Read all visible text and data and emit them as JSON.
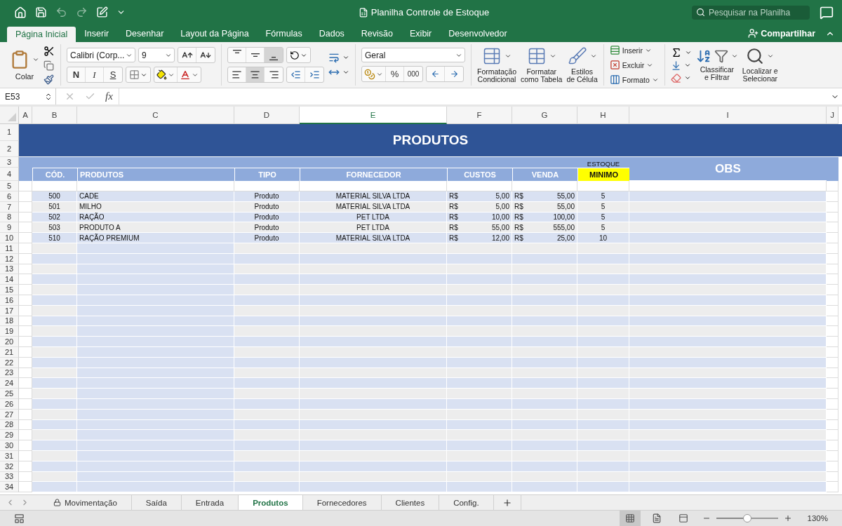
{
  "title_bar": {
    "title": "Planilha Controle de Estoque",
    "search_placeholder": "Pesquisar na Planilha"
  },
  "ribbon_tabs": [
    {
      "label": "Página Inicial",
      "selected": true
    },
    {
      "label": "Inserir",
      "selected": false
    },
    {
      "label": "Desenhar",
      "selected": false
    },
    {
      "label": "Layout da Página",
      "selected": false
    },
    {
      "label": "Fórmulas",
      "selected": false
    },
    {
      "label": "Dados",
      "selected": false
    },
    {
      "label": "Revisão",
      "selected": false
    },
    {
      "label": "Exibir",
      "selected": false
    },
    {
      "label": "Desenvolvedor",
      "selected": false
    }
  ],
  "share_label": "Compartilhar",
  "ribbon": {
    "paste_label": "Colar",
    "font_name": "Calibri (Corp...",
    "font_size": "9",
    "style_buttons": [
      {
        "kind": "bold",
        "label": "N"
      },
      {
        "kind": "italic",
        "label": "I"
      },
      {
        "kind": "underline",
        "label": "S"
      }
    ],
    "vertical_align": [
      {
        "kind": "top",
        "selected": false
      },
      {
        "kind": "middle",
        "selected": false
      },
      {
        "kind": "bottom",
        "selected": true
      }
    ],
    "horizontal_align": [
      {
        "kind": "left",
        "selected": false
      },
      {
        "kind": "center",
        "selected": true
      },
      {
        "kind": "right",
        "selected": false
      }
    ],
    "number_format": "Geral",
    "percent_label": "%",
    "thousands_label": "000",
    "large_buttons": [
      {
        "kind": "conditional",
        "label": "Formatação\nCondicional"
      },
      {
        "kind": "table",
        "label": "Formatar\ncomo Tabela"
      },
      {
        "kind": "cell_styles",
        "label": "Estilos\nde Célula"
      }
    ],
    "cells_buttons": [
      {
        "kind": "insert",
        "label": "Inserir"
      },
      {
        "kind": "delete",
        "label": "Excluir"
      },
      {
        "kind": "format",
        "label": "Formato"
      }
    ],
    "edit_buttons": [
      {
        "kind": "sort",
        "label": "Classificar\ne Filtrar"
      },
      {
        "kind": "find",
        "label": "Localizar e\nSelecionar"
      }
    ]
  },
  "formula_bar": {
    "name_box": "E53",
    "fx_label": "fx"
  },
  "sheet": {
    "columns": [
      {
        "label": "A",
        "selected": false
      },
      {
        "label": "B",
        "selected": false
      },
      {
        "label": "C",
        "selected": false
      },
      {
        "label": "D",
        "selected": false
      },
      {
        "label": "E",
        "selected": true
      },
      {
        "label": "F",
        "selected": false
      },
      {
        "label": "G",
        "selected": false
      },
      {
        "label": "H",
        "selected": false
      },
      {
        "label": "I",
        "selected": false
      },
      {
        "label": "J",
        "selected": false
      }
    ],
    "row_numbers": [
      "1",
      "2",
      "3",
      "4",
      "5",
      "6",
      "7",
      "8",
      "9",
      "10",
      "11",
      "12",
      "13",
      "14",
      "15",
      "16",
      "17",
      "18",
      "19",
      "20",
      "21",
      "22",
      "23",
      "24",
      "25",
      "26",
      "27",
      "28",
      "29",
      "30",
      "31",
      "32",
      "33",
      "34"
    ],
    "title": "PRODUTOS",
    "estoque_label": "ESTOQUE",
    "obs_label": "OBS",
    "headers": [
      "CÓD.",
      "PRODUTOS",
      "TIPO",
      "FORNECEDOR",
      "CUSTOS",
      "VENDA",
      "MINIMO"
    ],
    "rows": [
      {
        "code": "500",
        "product": "CADE",
        "type": "Produto",
        "supplier": "MATERIAL SILVA LTDA",
        "cost_currency": "R$",
        "cost": "5,00",
        "sale_currency": "R$",
        "sale": "55,00",
        "minimum": "5"
      },
      {
        "code": "501",
        "product": "MILHO",
        "type": "Produto",
        "supplier": "MATERIAL SILVA LTDA",
        "cost_currency": "R$",
        "cost": "5,00",
        "sale_currency": "R$",
        "sale": "55,00",
        "minimum": "5"
      },
      {
        "code": "502",
        "product": "RAÇÃO",
        "type": "Produto",
        "supplier": "PET LTDA",
        "cost_currency": "R$",
        "cost": "10,00",
        "sale_currency": "R$",
        "sale": "100,00",
        "minimum": "5"
      },
      {
        "code": "503",
        "product": "PRODUTO A",
        "type": "Produto",
        "supplier": "PET LTDA",
        "cost_currency": "R$",
        "cost": "55,00",
        "sale_currency": "R$",
        "sale": "555,00",
        "minimum": "5"
      },
      {
        "code": "510",
        "product": "RAÇÃO PREMIUM",
        "type": "Produto",
        "supplier": "MATERIAL SILVA LTDA",
        "cost_currency": "R$",
        "cost": "12,00",
        "sale_currency": "R$",
        "sale": "25,00",
        "minimum": "10"
      }
    ]
  },
  "sheet_tabs": [
    {
      "label": "Movimentação",
      "selected": false,
      "locked": true
    },
    {
      "label": "Saída",
      "selected": false,
      "locked": false
    },
    {
      "label": "Entrada",
      "selected": false,
      "locked": false
    },
    {
      "label": "Produtos",
      "selected": true,
      "locked": false
    },
    {
      "label": "Fornecedores",
      "selected": false,
      "locked": false
    },
    {
      "label": "Clientes",
      "selected": false,
      "locked": false
    },
    {
      "label": "Config.",
      "selected": false,
      "locked": false
    }
  ],
  "status_bar": {
    "views": [
      {
        "kind": "normal",
        "selected": true
      },
      {
        "kind": "page_layout",
        "selected": false
      },
      {
        "kind": "page_break",
        "selected": false
      }
    ],
    "zoom": {
      "level": 0.5,
      "label": "130%"
    }
  }
}
